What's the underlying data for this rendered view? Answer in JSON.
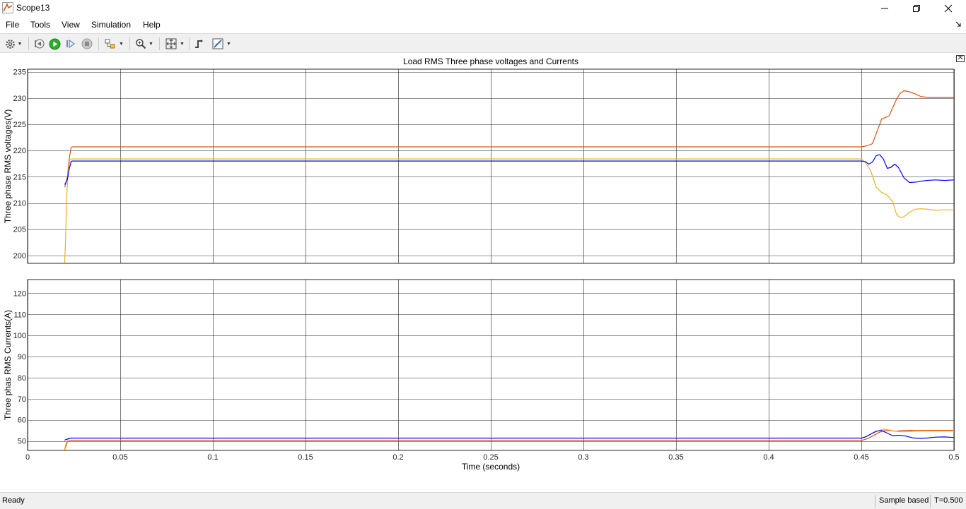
{
  "window": {
    "title": "Scope13",
    "minimize_icon": "minimize-icon",
    "maximize_icon": "restore-icon",
    "close_icon": "close-icon"
  },
  "menu": {
    "items": [
      "File",
      "Tools",
      "View",
      "Simulation",
      "Help"
    ]
  },
  "toolbar": {
    "icons": [
      "settings-icon",
      "step-back-icon",
      "run-icon",
      "step-forward-icon",
      "stop-icon",
      "highlight-icon",
      "zoom-icon",
      "fit-to-view-icon",
      "triggers-icon",
      "cursor-measure-icon"
    ]
  },
  "status": {
    "text": "Ready",
    "mode": "Sample based",
    "time": "T=0.500"
  },
  "colors": {
    "phase_a": "#d95319",
    "phase_b": "#edb120",
    "phase_c": "#0000ff",
    "grid": "#262626",
    "accent_run": "#2bb02b"
  },
  "chart_data": [
    {
      "type": "line",
      "title": "Load RMS Three phase voltages and Currents",
      "xlabel": "",
      "ylabel": "Three phase RMS voltages(V)",
      "xlim": [
        0,
        0.5
      ],
      "ylim": [
        198.5,
        235.5
      ],
      "yticks": [
        200,
        205,
        210,
        215,
        220,
        225,
        230,
        235
      ],
      "xticks": [
        0,
        0.05,
        0.1,
        0.15,
        0.2,
        0.25,
        0.3,
        0.35,
        0.4,
        0.45,
        0.5
      ],
      "grid": true,
      "series": [
        {
          "color": "#d95319",
          "x": [
            0.02,
            0.0205,
            0.0215,
            0.0225,
            0.0235,
            0.024,
            0.45,
            0.453,
            0.456,
            0.458,
            0.461,
            0.463,
            0.465,
            0.467,
            0.469,
            0.471,
            0.473,
            0.476,
            0.479,
            0.482,
            0.486,
            0.49,
            0.495,
            0.5
          ],
          "y": [
            213,
            213.5,
            215,
            218.5,
            220.6,
            220.7,
            220.7,
            220.9,
            221.3,
            223.2,
            226,
            226.3,
            226.6,
            228.2,
            229.8,
            230.9,
            231.4,
            231.2,
            230.8,
            230.3,
            230.1,
            230.1,
            230.1,
            230.1
          ]
        },
        {
          "color": "#edb120",
          "x": [
            0.02,
            0.0205,
            0.021,
            0.0218,
            0.0228,
            0.024,
            0.45,
            0.452,
            0.455,
            0.458,
            0.461,
            0.464,
            0.467,
            0.469,
            0.471,
            0.473,
            0.476,
            0.479,
            0.482,
            0.486,
            0.49,
            0.495,
            0.5
          ],
          "y": [
            198.6,
            203,
            210,
            215.5,
            218.3,
            218.4,
            218.4,
            217.8,
            216.2,
            213,
            212,
            211.5,
            210.2,
            207.8,
            207.2,
            207.4,
            208.2,
            208.8,
            208.9,
            208.8,
            208.6,
            208.7,
            208.7
          ]
        },
        {
          "color": "#0000ff",
          "x": [
            0.02,
            0.0205,
            0.0215,
            0.0225,
            0.0235,
            0.024,
            0.45,
            0.452,
            0.454,
            0.456,
            0.458,
            0.46,
            0.462,
            0.464,
            0.466,
            0.468,
            0.47,
            0.473,
            0.476,
            0.48,
            0.485,
            0.49,
            0.495,
            0.5
          ],
          "y": [
            213.5,
            213.8,
            214.5,
            216.5,
            217.9,
            218.0,
            218.0,
            217.9,
            217.4,
            217.8,
            219.0,
            219.2,
            218.3,
            216.6,
            216.8,
            217.4,
            216.8,
            214.8,
            213.9,
            214.0,
            214.3,
            214.4,
            214.3,
            214.4
          ]
        }
      ]
    },
    {
      "type": "line",
      "title": "",
      "xlabel": "Time (seconds)",
      "ylabel": "Three phas RMS Currents(A)",
      "xlim": [
        0,
        0.5
      ],
      "ylim": [
        45.5,
        126.5
      ],
      "yticks": [
        50,
        60,
        70,
        80,
        90,
        100,
        110,
        120
      ],
      "xticks": [
        0,
        0.05,
        0.1,
        0.15,
        0.2,
        0.25,
        0.3,
        0.35,
        0.4,
        0.45,
        0.5
      ],
      "xticklabels": [
        "0",
        "0.05",
        "0.1",
        "0.15",
        "0.2",
        "0.25",
        "0.3",
        "0.35",
        "0.4",
        "0.45",
        "0.5"
      ],
      "grid": true,
      "series": [
        {
          "color": "#d95319",
          "x": [
            0.02,
            0.0205,
            0.0215,
            0.023,
            0.024,
            0.45,
            0.453,
            0.456,
            0.459,
            0.462,
            0.465,
            0.468,
            0.472,
            0.476,
            0.48,
            0.485,
            0.49,
            0.495,
            0.5
          ],
          "y": [
            45.6,
            47,
            49.5,
            50.2,
            50.2,
            50.2,
            51,
            52.3,
            53.8,
            54.8,
            55,
            54.6,
            54.9,
            55,
            54.9,
            55,
            55,
            55,
            55
          ]
        },
        {
          "color": "#edb120",
          "x": [
            0.02,
            0.0205,
            0.0215,
            0.0225,
            0.024,
            0.45,
            0.453,
            0.456,
            0.459,
            0.462,
            0.465,
            0.468,
            0.472,
            0.476,
            0.48,
            0.485,
            0.49,
            0.495,
            0.5
          ],
          "y": [
            45.8,
            48,
            50.3,
            51.3,
            51.4,
            51.4,
            52.3,
            53.6,
            54.8,
            55.6,
            55.2,
            54.6,
            54.3,
            54.5,
            54.6,
            54.7,
            54.7,
            54.7,
            54.7
          ]
        },
        {
          "color": "#0000ff",
          "x": [
            0.02,
            0.0205,
            0.0215,
            0.0225,
            0.024,
            0.45,
            0.452,
            0.455,
            0.458,
            0.461,
            0.464,
            0.467,
            0.47,
            0.474,
            0.478,
            0.482,
            0.486,
            0.49,
            0.495,
            0.5
          ],
          "y": [
            50.3,
            50.6,
            50.9,
            51.2,
            51.3,
            51.3,
            51.8,
            53.2,
            54.6,
            54.9,
            53.7,
            52.4,
            52.7,
            52.3,
            51.4,
            51.2,
            51.4,
            51.8,
            51.9,
            51.6
          ]
        }
      ]
    }
  ]
}
